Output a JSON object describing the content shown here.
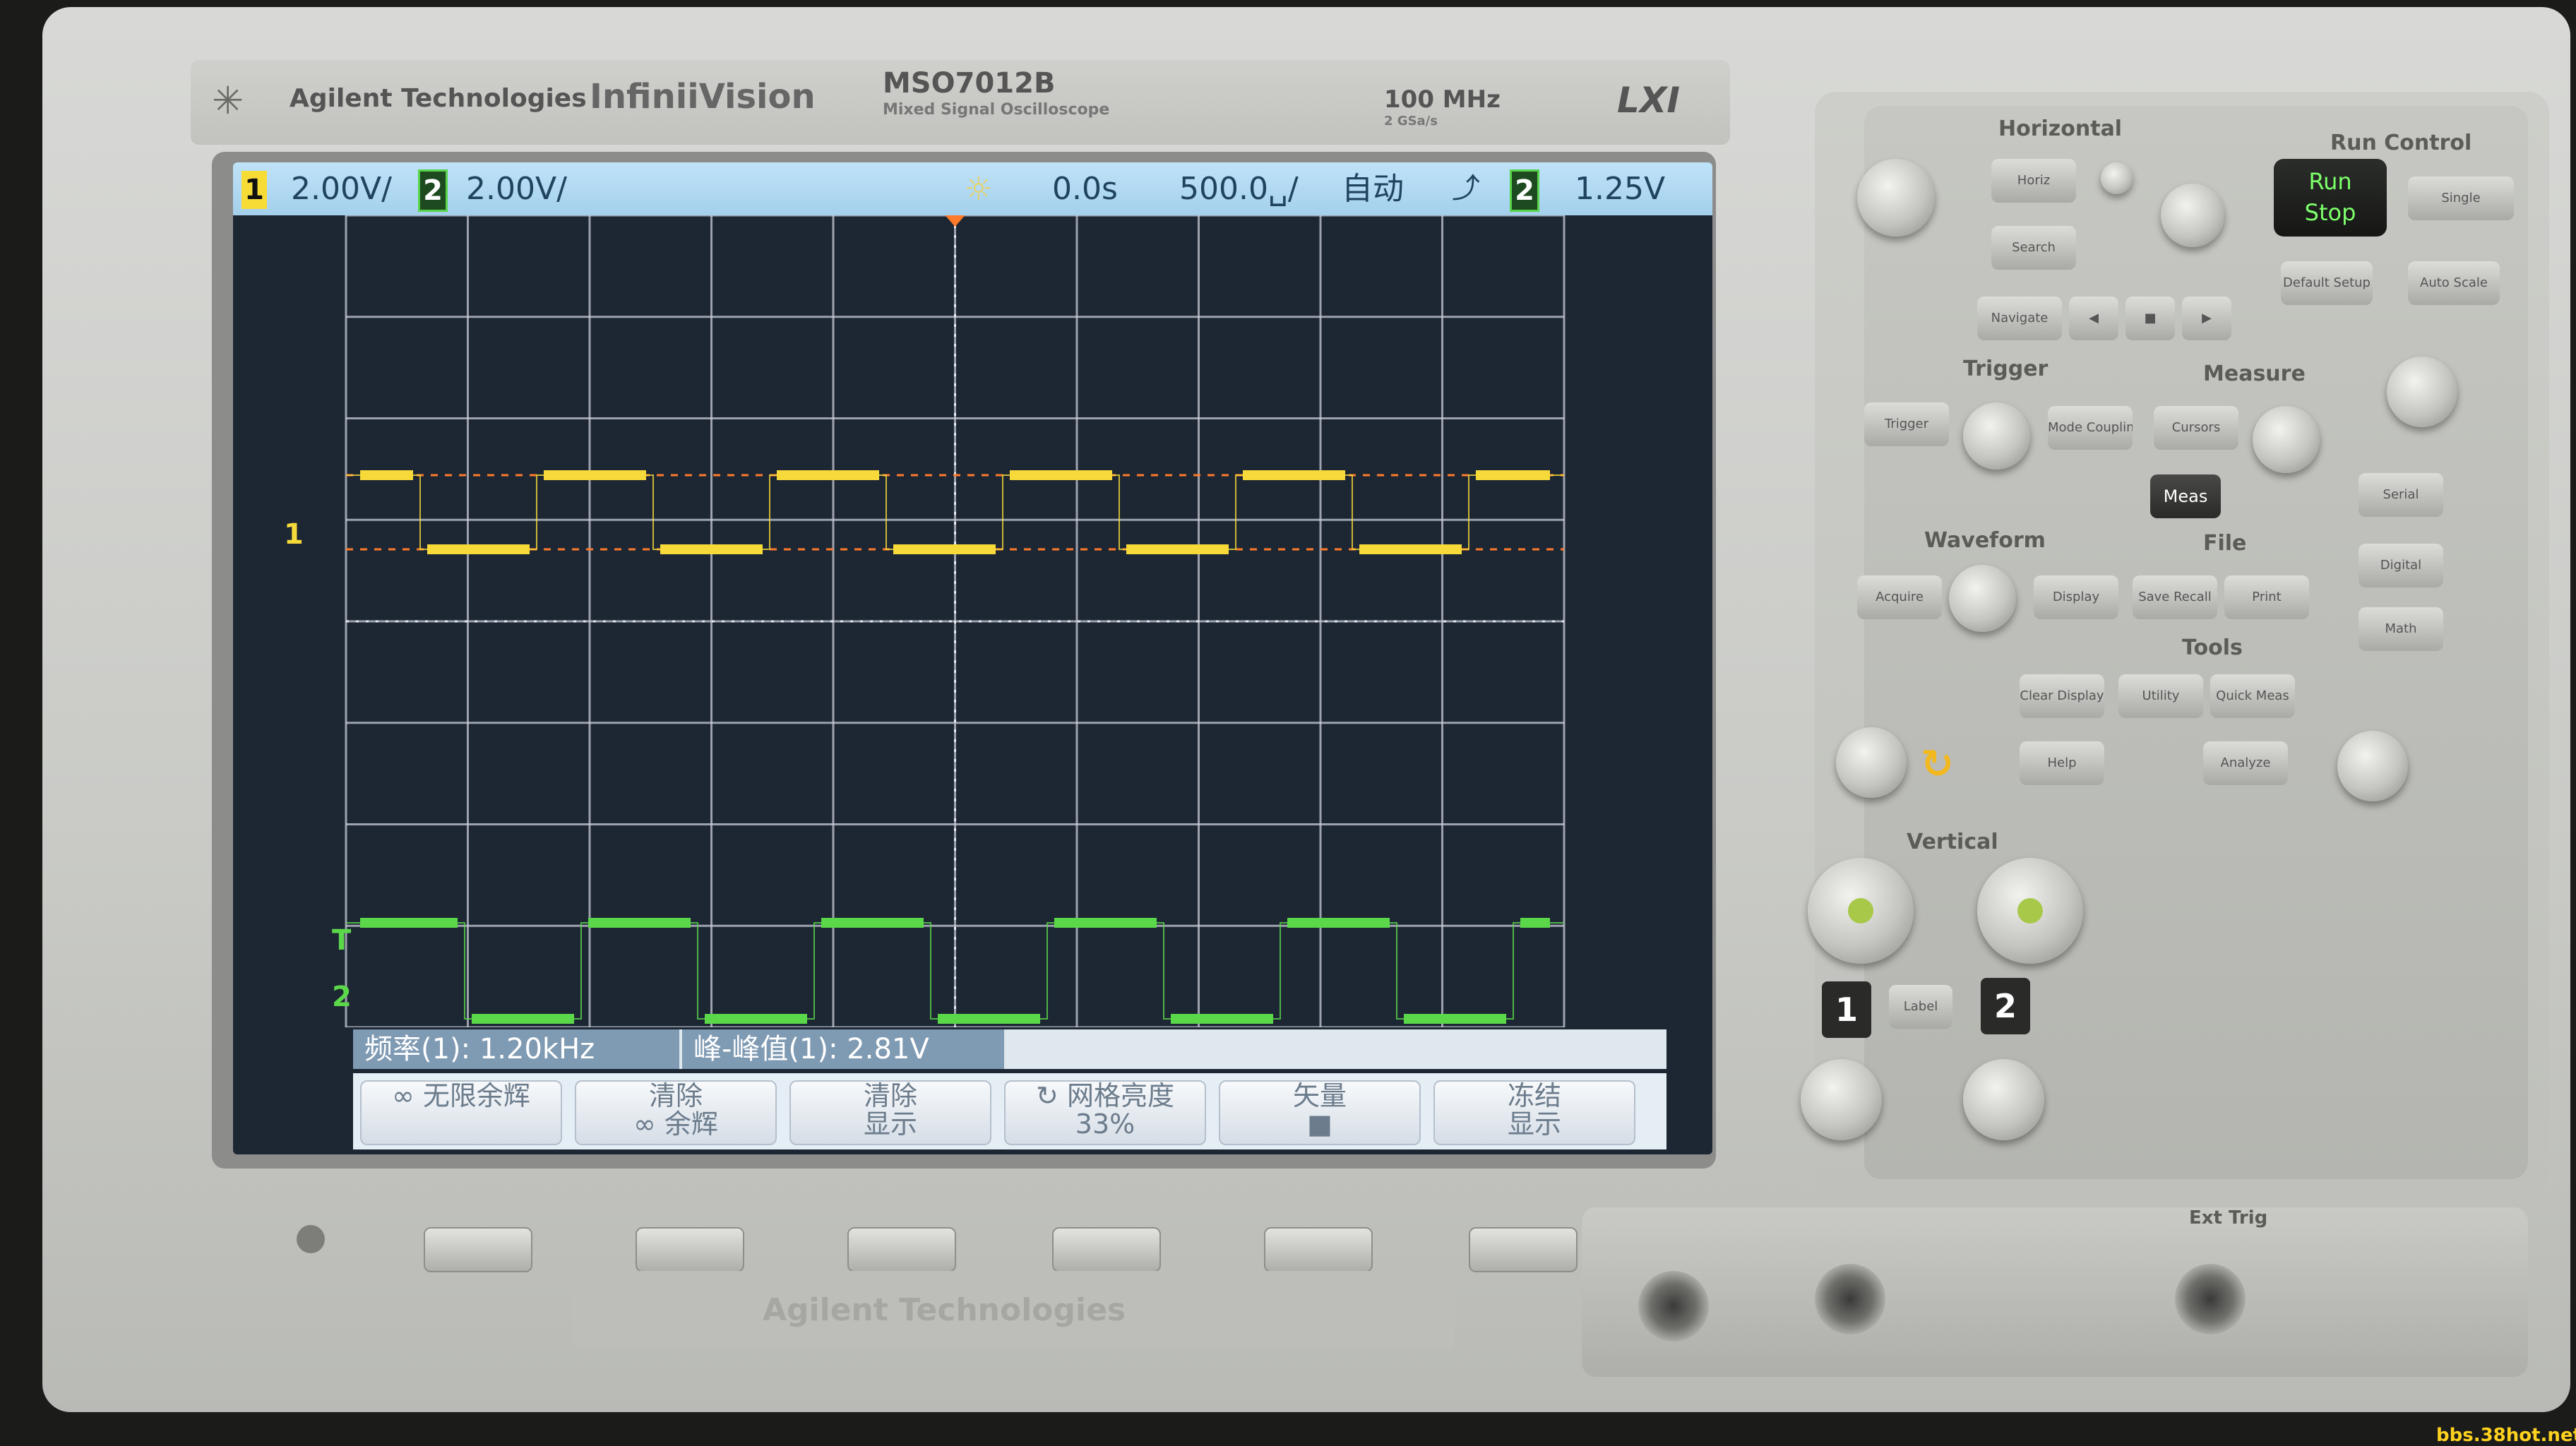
{
  "header": {
    "brand": "Agilent Technologies",
    "series": "InfiniiVision",
    "model": "MSO7012B",
    "model_subtitle": "Mixed Signal Oscilloscope",
    "bandwidth": "100 MHz",
    "sample_rate": "2 GSa/s",
    "lxi": "LXI"
  },
  "status_bar": {
    "ch1_label": "1",
    "ch1_scale": "2.00V/",
    "ch2_label": "2",
    "ch2_scale": "2.00V/",
    "time_delay": "0.0s",
    "time_scale": "500.0␣/",
    "trigger_mode": "自动",
    "trigger_slope_icon": "rising-edge-icon",
    "trigger_source": "2",
    "trigger_level": "1.25V"
  },
  "colors": {
    "ch1": "#f7d93a",
    "ch2": "#5bd84a",
    "grid": "#c8ccd6",
    "screen_bg": "#1d2734",
    "status_bg": "#b4dbf4",
    "trigger_marker": "#ff7a2a"
  },
  "waveforms": {
    "ch1": {
      "frequency_label": "1.20kHz",
      "duty": 0.5
    },
    "ch2": {
      "duty": 0.5
    }
  },
  "markers": {
    "ch1_ground": "1",
    "trigger_level_marker": "T",
    "ch2_ground": "2"
  },
  "measurements": [
    {
      "label": "频率(1): 1.20kHz"
    },
    {
      "label": "峰-峰值(1): 2.81V"
    }
  ],
  "softkeys": [
    {
      "line1": "∞ 无限余辉",
      "line2": ""
    },
    {
      "line1": "清除",
      "line2": "∞ 余辉"
    },
    {
      "line1": "清除",
      "line2": "显示"
    },
    {
      "line1": "↻ 网格亮度",
      "line2": "33%"
    },
    {
      "line1": "矢量",
      "line2": "■"
    },
    {
      "line1": "冻结",
      "line2": "显示"
    }
  ],
  "panel": {
    "horizontal": "Horizontal",
    "run_control": "Run Control",
    "horiz_btn": "Horiz",
    "search_btn": "Search",
    "navigate_btn": "Navigate",
    "run_label": "Run",
    "stop_label": "Stop",
    "single_btn": "Single",
    "default_setup_btn": "Default Setup",
    "auto_scale_btn": "Auto Scale",
    "trigger": "Trigger",
    "measure": "Measure",
    "trigger_btn": "Trigger",
    "mode_coupling_btn": "Mode Coupling",
    "cursors_btn": "Cursors",
    "meas_btn": "Meas",
    "waveform": "Waveform",
    "file": "File",
    "acquire_btn": "Acquire",
    "display_btn": "Display",
    "save_recall_btn": "Save Recall",
    "print_btn": "Print",
    "tools": "Tools",
    "clear_display_btn": "Clear Display",
    "utility_btn": "Utility",
    "quick_meas_btn": "Quick Meas",
    "help_btn": "Help",
    "analyze_btn": "Analyze",
    "serial_btn": "Serial",
    "digital_btn": "Digital",
    "math_btn": "Math",
    "vertical": "Vertical",
    "ch1_key": "1",
    "ch2_key": "2",
    "label_btn": "Label",
    "ext_trig": "Ext Trig"
  },
  "front_logo": "Agilent Technologies",
  "watermark": "bbs.38hot.net"
}
